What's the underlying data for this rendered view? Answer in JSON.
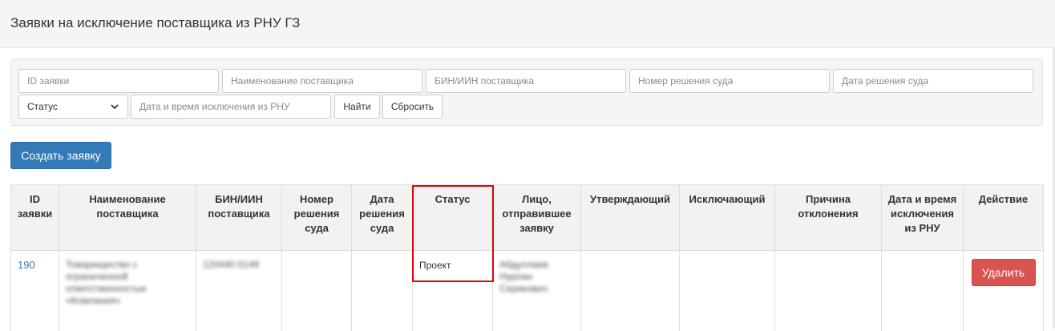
{
  "page": {
    "title": "Заявки на исключение поставщика из РНУ ГЗ"
  },
  "filters": {
    "request_id_placeholder": "ID заявки",
    "supplier_name_placeholder": "Наименование поставщика",
    "bin_placeholder": "БИН/ИИН поставщика",
    "court_decision_number_placeholder": "Номер решения суда",
    "court_decision_date_placeholder": "Дата решения суда",
    "status_value": "Статус",
    "exclusion_datetime_placeholder": "Дата и время исключения из РНУ",
    "search_label": "Найти",
    "reset_label": "Сбросить"
  },
  "actions": {
    "create_label": "Создать заявку"
  },
  "table": {
    "headers": [
      "ID заявки",
      "Наименование поставщика",
      "БИН/ИИН поставщика",
      "Номер решения суда",
      "Дата решения суда",
      "Статус",
      "Лицо, отправившее заявку",
      "Утверждающий",
      "Исключающий",
      "Причина отклонения",
      "Дата и время исключения из РНУ",
      "Действие"
    ],
    "rows": [
      {
        "id": "190",
        "supplier_name": "Товарищество с ограниченной ответственностью «Компания»",
        "bin": "120440 0149",
        "court_decision_number": "",
        "court_decision_date": "",
        "status": "Проект",
        "sender": "Абдуллаев Нурлан Серикович",
        "approver": "",
        "excluder": "",
        "rejection_reason": "",
        "exclusion_datetime": "",
        "action_label": "Удалить"
      }
    ]
  },
  "colors": {
    "primary": "#337ab7",
    "danger": "#d9534f",
    "highlight_frame": "#e3000b",
    "panel_bg": "#f5f5f5"
  }
}
